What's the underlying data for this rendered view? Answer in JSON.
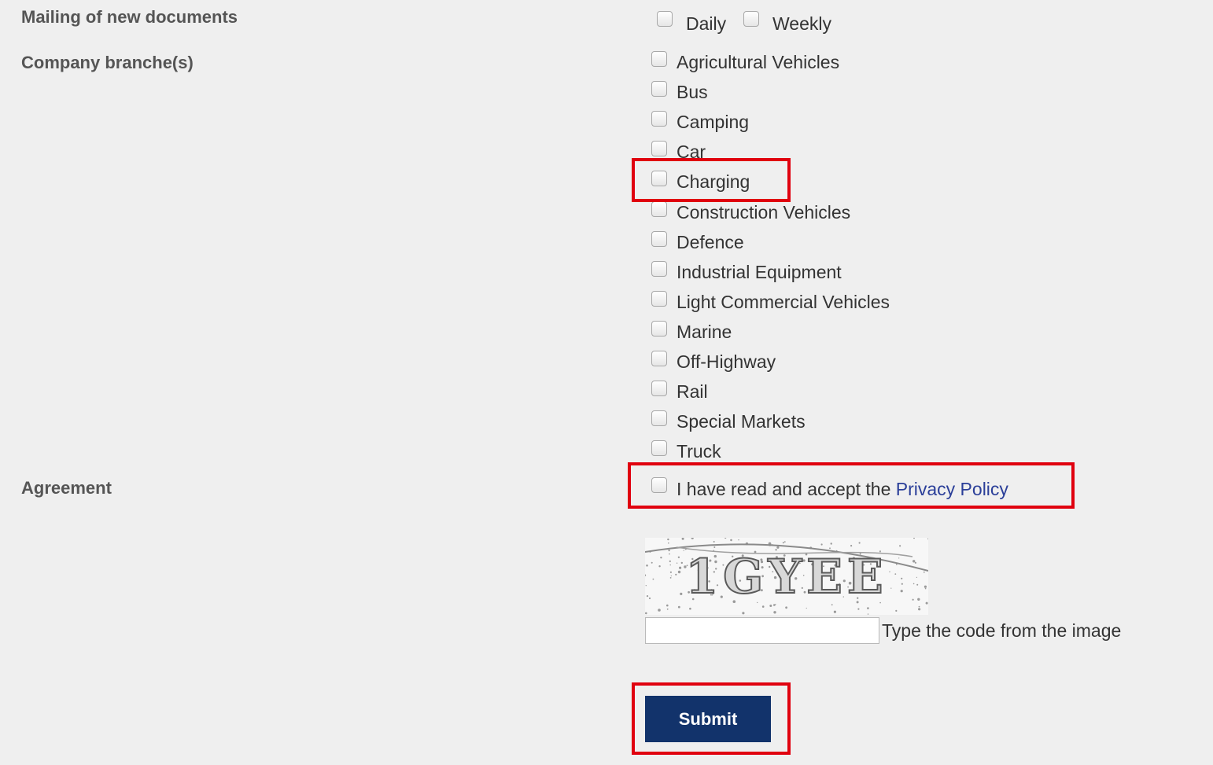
{
  "mailing": {
    "label": "Mailing of new documents",
    "options": [
      {
        "label": "Daily",
        "checked": false
      },
      {
        "label": "Weekly",
        "checked": false
      }
    ]
  },
  "branches": {
    "label": "Company branche(s)",
    "items": [
      {
        "label": "Agricultural Vehicles",
        "checked": false
      },
      {
        "label": "Bus",
        "checked": false
      },
      {
        "label": "Camping",
        "checked": false
      },
      {
        "label": "Car",
        "checked": false
      },
      {
        "label": "Charging",
        "checked": false
      },
      {
        "label": "Construction Vehicles",
        "checked": false
      },
      {
        "label": "Defence",
        "checked": false
      },
      {
        "label": "Industrial Equipment",
        "checked": false
      },
      {
        "label": "Light Commercial Vehicles",
        "checked": false
      },
      {
        "label": "Marine",
        "checked": false
      },
      {
        "label": "Off-Highway",
        "checked": false
      },
      {
        "label": "Rail",
        "checked": false
      },
      {
        "label": "Special Markets",
        "checked": false
      },
      {
        "label": "Truck",
        "checked": false
      }
    ]
  },
  "agreement": {
    "label": "Agreement",
    "text": "I have read and accept the ",
    "link_text": "Privacy Policy",
    "checked": false
  },
  "captcha": {
    "code": "1GYEE",
    "input_value": "",
    "hint": "Type the code from the image"
  },
  "submit": {
    "label": "Submit"
  },
  "colors": {
    "background": "#efefef",
    "label_text": "#555555",
    "link": "#2b3f99",
    "submit_bg": "#12336b",
    "highlight": "#e0000f"
  }
}
